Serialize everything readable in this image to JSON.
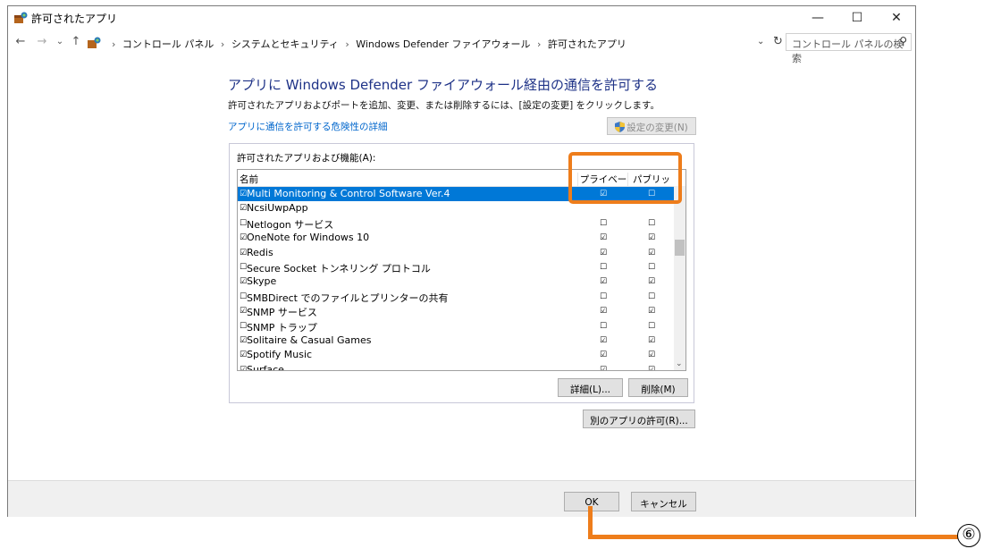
{
  "window": {
    "title": "許可されたアプリ",
    "controls": {
      "minimize": "—",
      "maximize": "☐",
      "close": "✕"
    }
  },
  "addressbar": {
    "back": "←",
    "forward": "→",
    "recent": "⌄",
    "up": "↑",
    "breadcrumb": [
      "コントロール パネル",
      "システムとセキュリティ",
      "Windows Defender ファイアウォール",
      "許可されたアプリ"
    ],
    "separator": "›",
    "dropdown": "⌄",
    "refresh": "↻",
    "search_placeholder": "コントロール パネルの検索"
  },
  "content": {
    "heading": "アプリに Windows Defender ファイアウォール経由の通信を許可する",
    "description": "許可されたアプリおよびポートを追加、変更、または削除するには、[設定の変更] をクリックします。",
    "risk_link": "アプリに通信を許可する危険性の詳細",
    "change_settings_button": "設定の変更(N)",
    "group_label": "許可されたアプリおよび機能(A):",
    "columns": {
      "name": "名前",
      "private": "プライベート",
      "public": "パブリック"
    },
    "rows": [
      {
        "name": "Multi Monitoring & Control Software Ver.4",
        "enabled": "☑",
        "private": "☑",
        "public": "☐",
        "selected": true
      },
      {
        "name": "NcsiUwpApp",
        "enabled": "☑",
        "private": "",
        "public": ""
      },
      {
        "name": "Netlogon サービス",
        "enabled": "☐",
        "private": "☐",
        "public": "☐"
      },
      {
        "name": "OneNote for Windows 10",
        "enabled": "☑",
        "private": "☑",
        "public": "☑"
      },
      {
        "name": "Redis",
        "enabled": "☑",
        "private": "☑",
        "public": "☑"
      },
      {
        "name": "Secure Socket トンネリング プロトコル",
        "enabled": "☐",
        "private": "☐",
        "public": "☐"
      },
      {
        "name": "Skype",
        "enabled": "☑",
        "private": "☑",
        "public": "☑"
      },
      {
        "name": "SMBDirect でのファイルとプリンターの共有",
        "enabled": "☐",
        "private": "☐",
        "public": "☐"
      },
      {
        "name": "SNMP サービス",
        "enabled": "☑",
        "private": "☑",
        "public": "☑"
      },
      {
        "name": "SNMP トラップ",
        "enabled": "☐",
        "private": "☐",
        "public": "☐"
      },
      {
        "name": "Solitaire & Casual Games",
        "enabled": "☑",
        "private": "☑",
        "public": "☑"
      },
      {
        "name": "Spotify Music",
        "enabled": "☑",
        "private": "☑",
        "public": "☑"
      },
      {
        "name": "Surface",
        "enabled": "☑",
        "private": "☑",
        "public": "☑"
      }
    ],
    "details_button": "詳細(L)...",
    "remove_button": "削除(M)",
    "allow_another_button": "別のアプリの許可(R)..."
  },
  "footer": {
    "ok_button": "OK",
    "cancel_button": "キャンセル"
  },
  "annotation": {
    "number": "⑥",
    "color": "#ee7d1b"
  },
  "colors": {
    "heading": "#1e3287",
    "link": "#0066cc",
    "selection": "#0078d7",
    "highlight": "#ee7d1b"
  }
}
